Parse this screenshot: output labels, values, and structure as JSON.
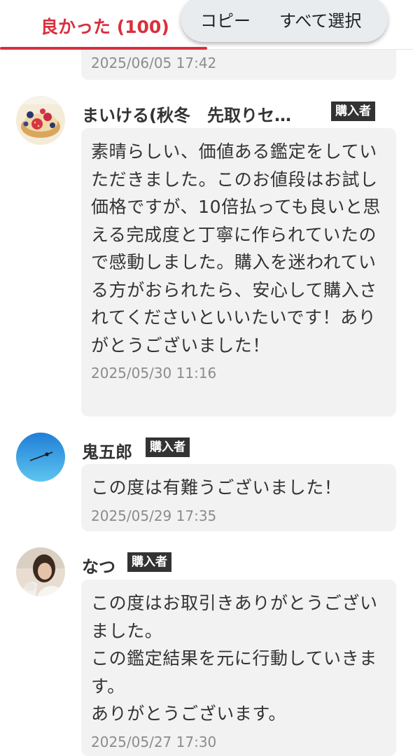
{
  "tabs": {
    "good_label": "良かった (100)"
  },
  "copy_popup": {
    "copy": "コピー",
    "select_all": "すべて選択"
  },
  "reviews": [
    {
      "date": "2025/06/05 17:42"
    },
    {
      "name": "まいける(秋冬　先取りセ…",
      "badge": "購入者",
      "text": "素晴らしい、価値ある鑑定をしていただきました。このお値段はお試し価格ですが、10倍払っても良いと思える完成度と丁寧に作られていたので感動しました。購入を迷われている方がおられたら、安心して購入されてくださいといいたいです！ありがとうございました！",
      "date": "2025/05/30 11:16"
    },
    {
      "name": "鬼五郎",
      "badge": "購入者",
      "text": "この度は有難うございました！",
      "date": "2025/05/29 17:35"
    },
    {
      "name": "なつ",
      "badge": "購入者",
      "text": "この度はお取引きありがとうございました。\nこの鑑定結果を元に行動していきます。\nありがとうございます。",
      "date": "2025/05/27 17:30"
    }
  ],
  "colors": {
    "accent": "#d9303d",
    "badge_bg": "#333333",
    "bubble_bg": "#f2f2f2",
    "date_text": "#8c8c8c"
  }
}
